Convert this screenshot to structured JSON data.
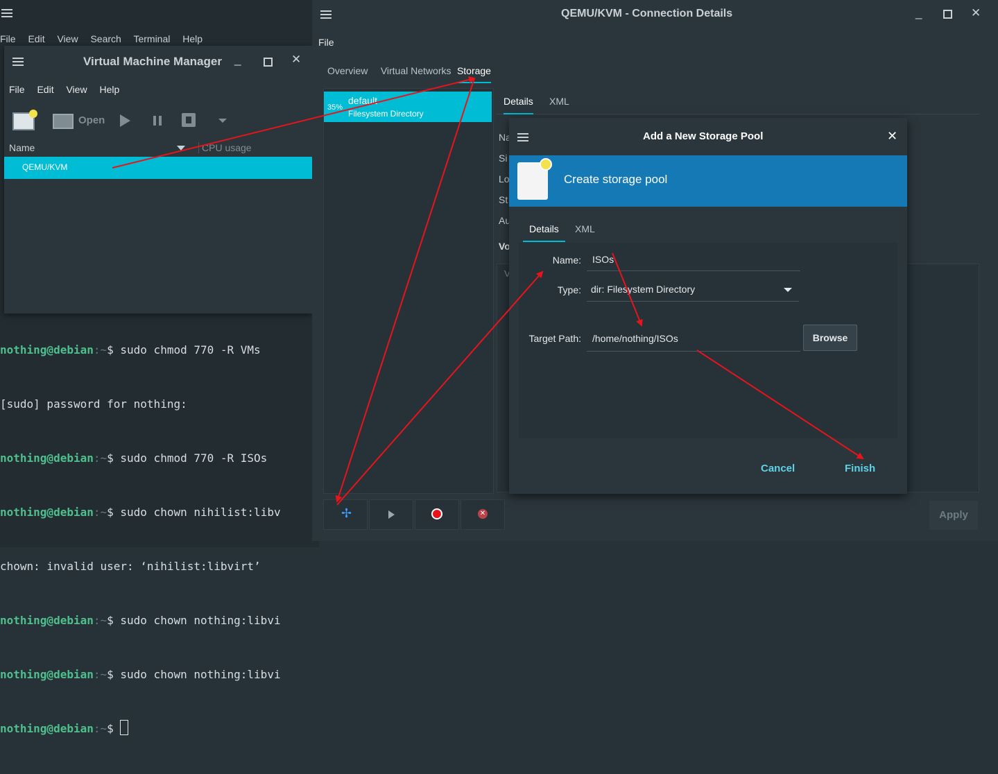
{
  "terminal": {
    "menu": [
      "File",
      "Edit",
      "View",
      "Search",
      "Terminal",
      "Help"
    ],
    "lines": [
      {
        "user": "nothing@debian",
        "path": ":~",
        "cmd": "$ sudo chmod 770 -R VMs"
      },
      {
        "plain": "[sudo] password for nothing:"
      },
      {
        "user": "nothing@debian",
        "path": ":~",
        "cmd": "$ sudo chmod 770 -R ISOs"
      },
      {
        "user": "nothing@debian",
        "path": ":~",
        "cmd": "$ sudo chown nihilist:libv"
      },
      {
        "plain": "chown: invalid user: ‘nihilist:libvirt’"
      },
      {
        "user": "nothing@debian",
        "path": ":~",
        "cmd": "$ sudo chown nothing:libvi"
      },
      {
        "user": "nothing@debian",
        "path": ":~",
        "cmd": "$ sudo chown nothing:libvi"
      },
      {
        "user": "nothing@debian",
        "path": ":~",
        "cmd": "$ "
      }
    ]
  },
  "vmm": {
    "title": "Virtual Machine Manager",
    "menu": [
      "File",
      "Edit",
      "View",
      "Help"
    ],
    "open_label": "Open",
    "columns": {
      "name": "Name",
      "cpu": "CPU usage"
    },
    "rows": [
      "QEMU/KVM"
    ]
  },
  "conn": {
    "title": "QEMU/KVM - Connection Details",
    "menu": [
      "File"
    ],
    "tabs": [
      "Overview",
      "Virtual Networks",
      "Storage"
    ],
    "active_tab": "Storage",
    "pool": {
      "percent": "35%",
      "name": "default",
      "type": "Filesystem Directory"
    },
    "detail_tabs": [
      "Details",
      "XML"
    ],
    "detail_labels": [
      "Na",
      "Si",
      "Lo",
      "St",
      "Au"
    ],
    "volumes_label": "Vo",
    "volumes_col": "V",
    "apply_label": "Apply"
  },
  "dialog": {
    "title": "Add a New Storage Pool",
    "banner": "Create storage pool",
    "tabs": [
      "Details",
      "XML"
    ],
    "name_label": "Name:",
    "name_value": "ISOs",
    "type_label": "Type:",
    "type_value": "dir: Filesystem Directory",
    "target_label": "Target Path:",
    "target_value": "/home/nothing/ISOs",
    "browse_label": "Browse",
    "cancel_label": "Cancel",
    "finish_label": "Finish"
  },
  "colors": {
    "accent": "#00bcd4",
    "banner": "#1479b5",
    "annotation": "#e8141b"
  }
}
